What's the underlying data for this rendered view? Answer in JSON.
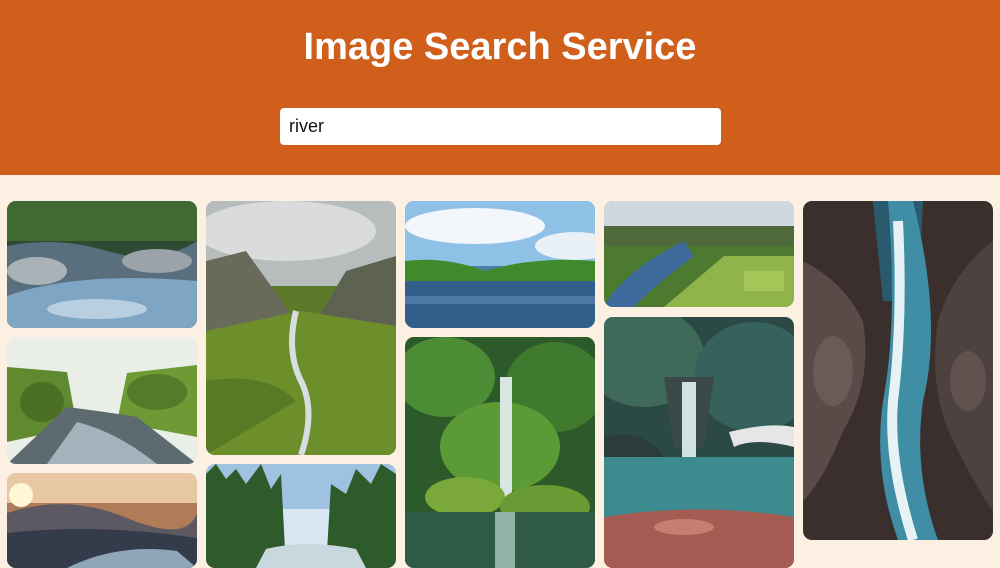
{
  "header": {
    "title": "Image Search Service",
    "background_color": "#d15f1c"
  },
  "search": {
    "value": "river"
  },
  "results": [
    {
      "subject": "rocky stream through forest"
    },
    {
      "subject": "green canyon with river"
    },
    {
      "subject": "river at sunrise among mountains"
    },
    {
      "subject": "aerial valley with winding river"
    },
    {
      "subject": "forest river with pine trees"
    },
    {
      "subject": "lake under blue sky"
    },
    {
      "subject": "jungle waterfall over reflecting pool"
    },
    {
      "subject": "winding river through green hills"
    },
    {
      "subject": "tropical waterfall with turquoise pool"
    },
    {
      "subject": "aerial waterfall through dark rocks"
    }
  ],
  "colors": {
    "page_background": "#fcf0e2",
    "title_text": "#ffffff"
  }
}
